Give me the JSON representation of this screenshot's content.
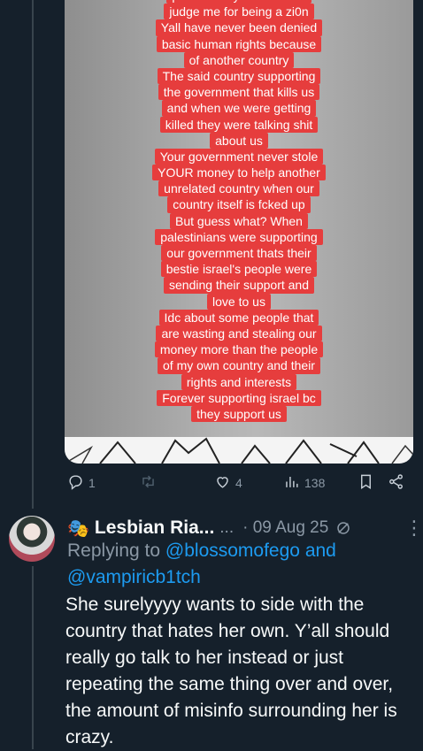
{
  "story_lines": [
    "problem in your life can't",
    "judge me for being a zi0n",
    "Yall have never been denied",
    "basic human rights because",
    "of another country",
    "The said country supporting",
    "the government that kills us",
    "and when we were getting",
    "killed they were talking shit",
    "about us",
    "Your government never stole",
    "YOUR money to help another",
    "unrelated country when our",
    "country itself is fcked up",
    "But guess what? When",
    "palestinians were supporting",
    "our government thats their",
    "bestie israel's people were",
    "sending their support and",
    "love to us",
    "Idc about some people that",
    "are wasting and stealing our",
    "money more than the people",
    "of my own country and their",
    "rights and interests",
    "Forever supporting israel bc",
    "they support us"
  ],
  "actions": {
    "replies": "1",
    "reposts": "",
    "likes": "4",
    "views": "138"
  },
  "reply": {
    "name": "Lesbian Ria...",
    "ellipsis": "...",
    "date": "· 09 Aug 25",
    "replying_prefix": "Replying to",
    "mention1": "@blossomofego",
    "and": "and",
    "mention2": "@vampiricb1tch",
    "text": "She surelyyyy wants to side with the country that hates her own. Y’all should really go talk to her instead or just repeating the same thing over and over, the amount of misinfo surrounding her is crazy."
  },
  "colors": {
    "background": "#15202b",
    "accent": "#1d9bf0",
    "story_bg": "#e63d3d",
    "muted": "#8b98a5"
  },
  "icons": [
    "reply-icon",
    "repost-icon",
    "like-icon",
    "views-icon",
    "bookmark-icon",
    "share-icon",
    "mask-emoji-icon",
    "grok-icon",
    "more-icon"
  ]
}
